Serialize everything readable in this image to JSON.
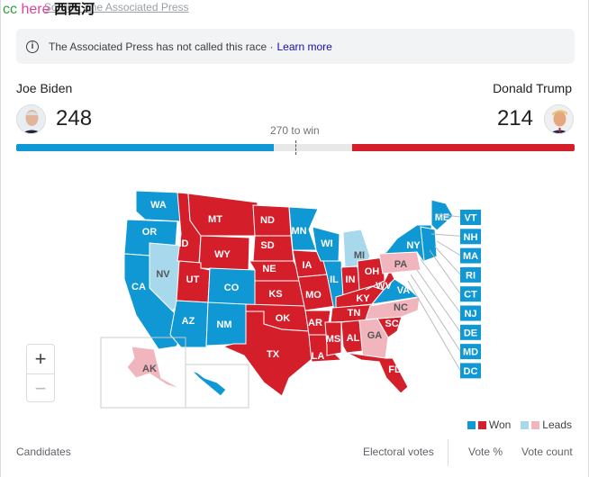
{
  "source_link": "Source: The Associated Press",
  "watermark": {
    "part1": "cc",
    "part2": "here",
    "part3": "西西河"
  },
  "notice": {
    "icon": "info-icon",
    "text": "The Associated Press has not called this race ·",
    "link": "Learn more"
  },
  "candidates": [
    {
      "name": "Joe Biden",
      "electoral_votes": "248",
      "color": "#0f98d4"
    },
    {
      "name": "Donald Trump",
      "electoral_votes": "214",
      "color": "#d41f2b"
    }
  ],
  "threshold_label": "270 to win",
  "threshold": 270,
  "total_electoral_votes": 538,
  "colors": {
    "dem_won": "#0f98d4",
    "rep_won": "#d41f2b",
    "dem_leads": "#a8d8ec",
    "rep_leads": "#f1b5bd"
  },
  "states": [
    {
      "code": "WA",
      "status": "dem_won"
    },
    {
      "code": "OR",
      "status": "dem_won"
    },
    {
      "code": "CA",
      "status": "dem_won"
    },
    {
      "code": "NV",
      "status": "dem_leads"
    },
    {
      "code": "ID",
      "status": "rep_won"
    },
    {
      "code": "MT",
      "status": "rep_won"
    },
    {
      "code": "WY",
      "status": "rep_won"
    },
    {
      "code": "UT",
      "status": "rep_won"
    },
    {
      "code": "CO",
      "status": "dem_won"
    },
    {
      "code": "AZ",
      "status": "dem_won"
    },
    {
      "code": "NM",
      "status": "dem_won"
    },
    {
      "code": "ND",
      "status": "rep_won"
    },
    {
      "code": "SD",
      "status": "rep_won"
    },
    {
      "code": "NE",
      "status": "rep_won"
    },
    {
      "code": "KS",
      "status": "rep_won"
    },
    {
      "code": "OK",
      "status": "rep_won"
    },
    {
      "code": "TX",
      "status": "rep_won"
    },
    {
      "code": "MN",
      "status": "dem_won"
    },
    {
      "code": "IA",
      "status": "rep_won"
    },
    {
      "code": "MO",
      "status": "rep_won"
    },
    {
      "code": "AR",
      "status": "rep_won"
    },
    {
      "code": "LA",
      "status": "rep_won"
    },
    {
      "code": "WI",
      "status": "dem_won"
    },
    {
      "code": "IL",
      "status": "dem_won"
    },
    {
      "code": "MI",
      "status": "dem_leads"
    },
    {
      "code": "IN",
      "status": "rep_won"
    },
    {
      "code": "OH",
      "status": "rep_won"
    },
    {
      "code": "KY",
      "status": "rep_won"
    },
    {
      "code": "TN",
      "status": "rep_won"
    },
    {
      "code": "MS",
      "status": "rep_won"
    },
    {
      "code": "AL",
      "status": "rep_won"
    },
    {
      "code": "GA",
      "status": "rep_leads"
    },
    {
      "code": "FL",
      "status": "rep_won"
    },
    {
      "code": "SC",
      "status": "rep_won"
    },
    {
      "code": "NC",
      "status": "rep_leads"
    },
    {
      "code": "VA",
      "status": "dem_won"
    },
    {
      "code": "WV",
      "status": "rep_won"
    },
    {
      "code": "PA",
      "status": "rep_leads"
    },
    {
      "code": "NY",
      "status": "dem_won"
    },
    {
      "code": "ME",
      "status": "dem_won"
    },
    {
      "code": "AK",
      "status": "rep_leads"
    },
    {
      "code": "HI",
      "status": "dem_won"
    }
  ],
  "small_states": [
    {
      "code": "VT",
      "status": "dem_won"
    },
    {
      "code": "NH",
      "status": "dem_won"
    },
    {
      "code": "MA",
      "status": "dem_won"
    },
    {
      "code": "RI",
      "status": "dem_won"
    },
    {
      "code": "CT",
      "status": "dem_won"
    },
    {
      "code": "NJ",
      "status": "dem_won"
    },
    {
      "code": "DE",
      "status": "dem_won"
    },
    {
      "code": "MD",
      "status": "dem_won"
    },
    {
      "code": "DC",
      "status": "dem_won"
    }
  ],
  "zoom": {
    "in": "+",
    "out": "−"
  },
  "legend": {
    "won": "Won",
    "leads": "Leads"
  },
  "table_headers": {
    "candidates": "Candidates",
    "electoral_votes": "Electoral votes",
    "vote_pct": "Vote %",
    "vote_count": "Vote count"
  }
}
